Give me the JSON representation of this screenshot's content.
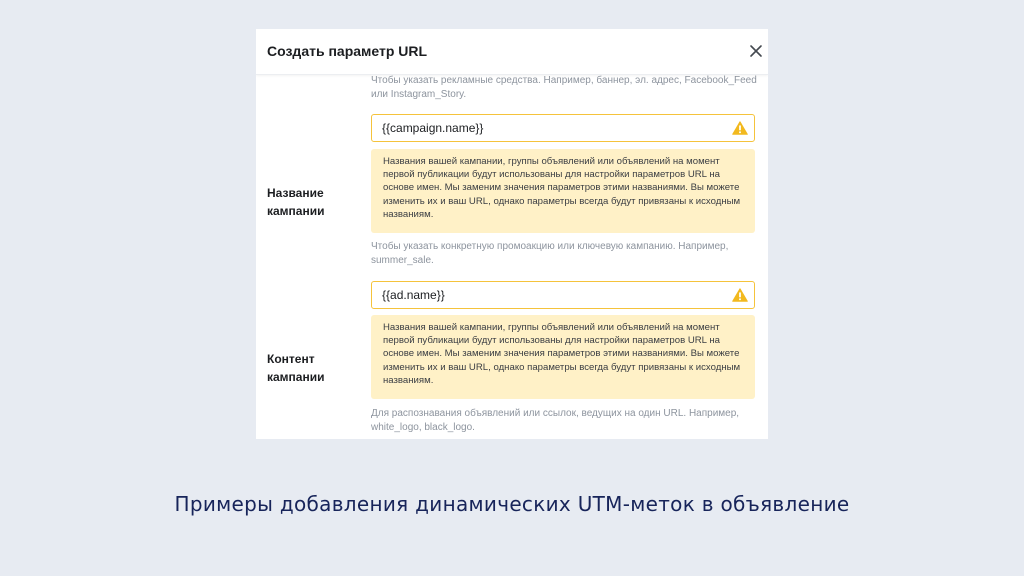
{
  "dialog": {
    "title": "Создать параметр URL",
    "close_icon": "close-icon"
  },
  "sections": {
    "source_hint": "Чтобы указать рекламные средства. Например, баннер, эл. адрес, Facebook_Feed или Instagram_Story.",
    "campaign": {
      "label": "Название кампании",
      "value": "{{campaign.name}}",
      "warning_icon": "warning-triangle-icon",
      "warning": "Названия вашей кампании, группы объявлений или объявлений на момент первой публикации будут использованы для настройки параметров URL на основе имен. Мы заменим значения параметров этими названиями. Вы можете изменить их и ваш URL, однако параметры всегда будут привязаны к исходным названиям.",
      "hint": "Чтобы указать конкретную промоакцию или ключевую кампанию. Например, summer_sale."
    },
    "content": {
      "label": "Контент кампании",
      "value": "{{ad.name}}",
      "warning_icon": "warning-triangle-icon",
      "warning": "Названия вашей кампании, группы объявлений или объявлений на момент первой публикации будут использованы для настройки параметров URL на основе имен. Мы заменим значения параметров этими названиями. Вы можете изменить их и ваш URL, однако параметры всегда будут привязаны к исходным названиям.",
      "hint": "Для распознавания объявлений или ссылок, ведущих на один URL. Например, white_logo, black_logo."
    }
  },
  "caption": "Примеры добавления динамических UTM-меток в объявление",
  "colors": {
    "page_background": "#e7ebf2",
    "warning_border": "#f5c33b",
    "warning_background": "#fff1c7",
    "warning_icon": "#f2b91e",
    "caption_text": "#17245a"
  }
}
